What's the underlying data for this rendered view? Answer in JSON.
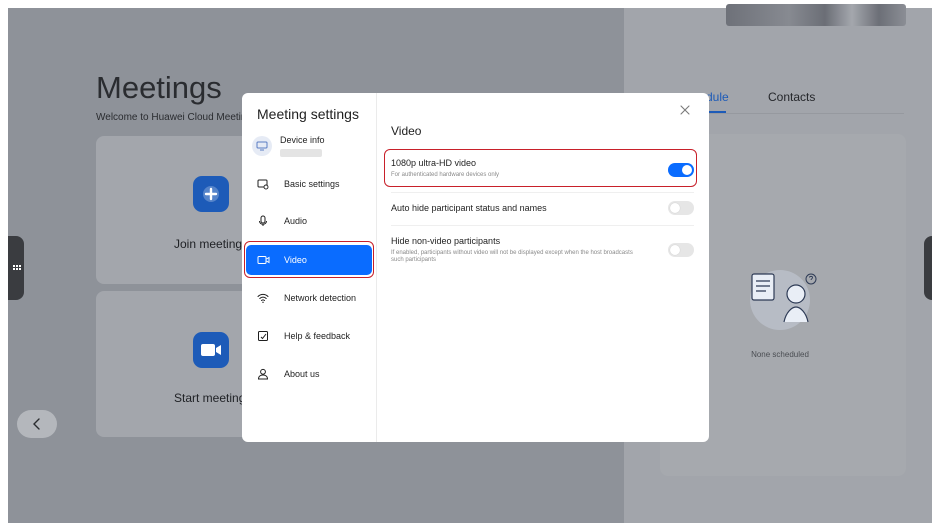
{
  "app": {
    "title": "Meetings",
    "subtitle": "Welcome to Huawei Cloud Meetin"
  },
  "cards": {
    "join_label": "Join meeting",
    "start_label": "Start meeting"
  },
  "right_panel": {
    "tab_schedule": "dule",
    "tab_contacts": "Contacts",
    "empty_text": "None scheduled"
  },
  "modal": {
    "title": "Meeting settings",
    "device_info_label": "Device info",
    "nav": [
      {
        "label": "Basic settings",
        "icon": "basic-settings-icon"
      },
      {
        "label": "Audio",
        "icon": "microphone-icon"
      },
      {
        "label": "Video",
        "icon": "video-camera-icon"
      },
      {
        "label": "Network detection",
        "icon": "wifi-icon"
      },
      {
        "label": "Help & feedback",
        "icon": "feedback-icon"
      },
      {
        "label": "About us",
        "icon": "person-icon"
      }
    ],
    "section_title": "Video",
    "settings": [
      {
        "title": "1080p ultra-HD video",
        "desc": "For authenticated hardware devices only",
        "enabled": true
      },
      {
        "title": "Auto hide participant status and names",
        "desc": "",
        "enabled": false
      },
      {
        "title": "Hide non-video participants",
        "desc": "If enabled, participants without video will not be displayed except when the host broadcasts such participants",
        "enabled": false
      }
    ]
  },
  "colors": {
    "accent": "#0a6cff",
    "highlight": "#c8202a"
  }
}
